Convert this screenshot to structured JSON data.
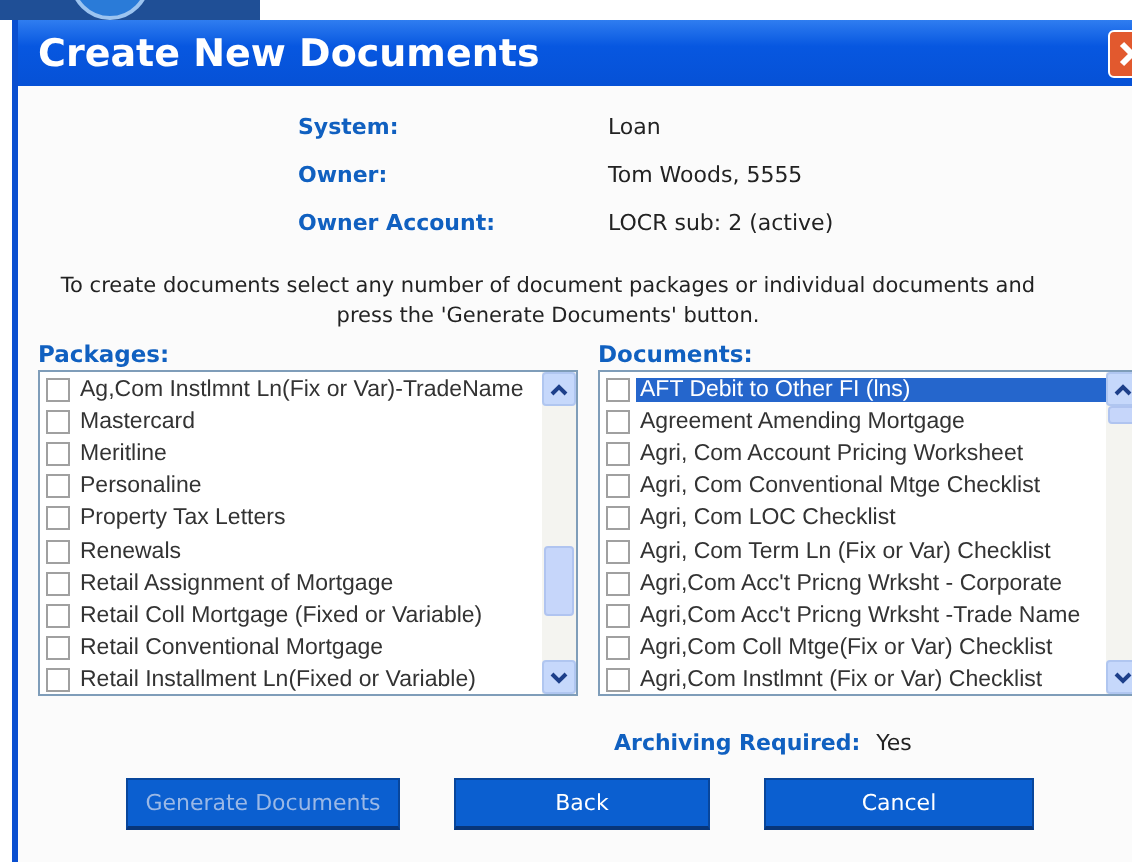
{
  "window": {
    "title": "Create New Documents"
  },
  "info": [
    {
      "label": "System:",
      "value": "Loan"
    },
    {
      "label": "Owner:",
      "value": "Tom Woods, 5555"
    },
    {
      "label": "Owner Account:",
      "value": "LOCR sub: 2 (active)"
    }
  ],
  "instructions": "To create documents select any number of document packages or individual documents and press the 'Generate Documents' button.",
  "packages": {
    "label": "Packages:",
    "items": [
      {
        "text": "Ag,Com Instlmnt Ln(Fix or Var)-TradeName",
        "checked": false,
        "selected": false
      },
      {
        "text": "Mastercard",
        "checked": false,
        "selected": false
      },
      {
        "text": "Meritline",
        "checked": false,
        "selected": false
      },
      {
        "text": "Personaline",
        "checked": false,
        "selected": false
      },
      {
        "text": "Property Tax Letters",
        "checked": false,
        "selected": false
      },
      {
        "text": "Renewals",
        "checked": false,
        "selected": false
      },
      {
        "text": "Retail Assignment of Mortgage",
        "checked": false,
        "selected": false
      },
      {
        "text": "Retail Coll Mortgage (Fixed or Variable)",
        "checked": false,
        "selected": false
      },
      {
        "text": "Retail Conventional Mortgage",
        "checked": false,
        "selected": false
      },
      {
        "text": "Retail Installment Ln(Fixed or Variable)",
        "checked": false,
        "selected": false
      }
    ]
  },
  "documents": {
    "label": "Documents:",
    "items": [
      {
        "text": "AFT Debit to Other FI (lns)",
        "checked": false,
        "selected": true
      },
      {
        "text": "Agreement Amending Mortgage",
        "checked": false,
        "selected": false
      },
      {
        "text": "Agri, Com Account Pricing Worksheet",
        "checked": false,
        "selected": false
      },
      {
        "text": "Agri, Com Conventional Mtge Checklist",
        "checked": false,
        "selected": false
      },
      {
        "text": "Agri, Com LOC Checklist",
        "checked": false,
        "selected": false
      },
      {
        "text": "Agri, Com Term Ln (Fix or Var) Checklist",
        "checked": false,
        "selected": false
      },
      {
        "text": "Agri,Com Acc't Pricng Wrksht - Corporate",
        "checked": false,
        "selected": false
      },
      {
        "text": "Agri,Com Acc't Pricng Wrksht -Trade Name",
        "checked": false,
        "selected": false
      },
      {
        "text": "Agri,Com Coll Mtge(Fix or Var) Checklist",
        "checked": false,
        "selected": false
      },
      {
        "text": "Agri,Com Instlmnt (Fix or Var) Checklist",
        "checked": false,
        "selected": false
      }
    ]
  },
  "archiving": {
    "label": "Archiving Required:",
    "value": "Yes"
  },
  "buttons": [
    {
      "label": "Generate Documents",
      "disabled": true
    },
    {
      "label": "Back",
      "disabled": false
    },
    {
      "label": "Cancel",
      "disabled": false
    }
  ]
}
